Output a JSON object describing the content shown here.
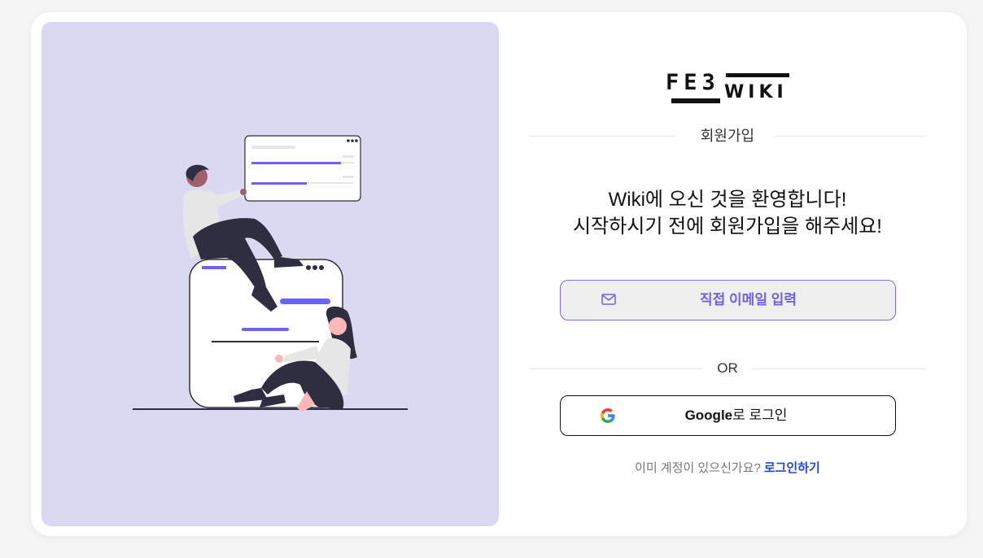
{
  "logo": {
    "top": "FE3",
    "bottom": "WIKI"
  },
  "signup_heading": "회원가입",
  "welcome": {
    "line1": "Wiki에 오신 것을 환영합니다!",
    "line2": "시작하시기 전에 회원가입을 해주세요!"
  },
  "email_button": {
    "label": "직접 이메일 입력",
    "icon": "mail-icon"
  },
  "or_label": "OR",
  "google_button": {
    "brand": "Google",
    "suffix": "로 로그인",
    "icon": "google-g-icon"
  },
  "login_prompt": {
    "text": "이미 계정이 있으신가요?",
    "link": "로그인하기"
  },
  "colors": {
    "accent": "#6d63e8",
    "illustration_bg": "#d9d9f1",
    "link": "#2346d8",
    "page_bg": "#f5f5f5"
  }
}
